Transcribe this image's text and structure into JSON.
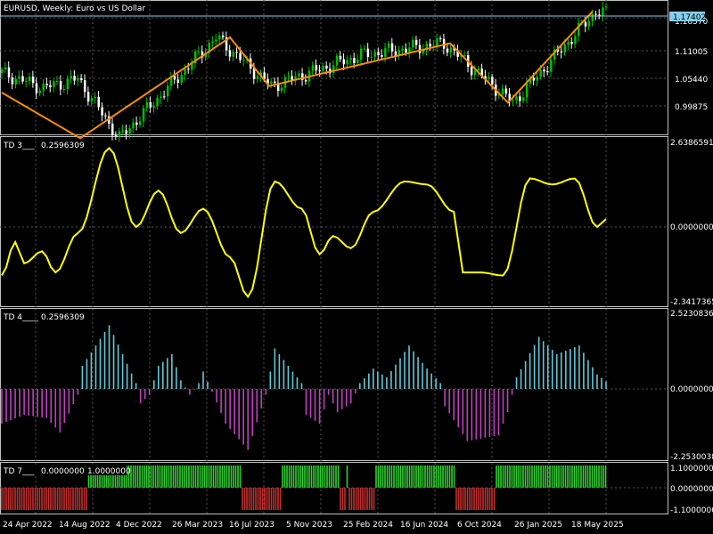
{
  "main_panel": {
    "title": "EURUSD, Weekly:  Euro vs US Dollar",
    "y_ticks": [
      "1.16570",
      "1.11005",
      "1.05440",
      "0.99875"
    ],
    "current_price": "1.17402",
    "colors": {
      "bull": "#00c000",
      "bear": "#ffffff",
      "zigzag": "#ff8c00",
      "price_line": "#87ceeb"
    }
  },
  "td3": {
    "label": "TD 3___",
    "value": "0.2596309",
    "y_ticks": [
      "2.6386591",
      "0.0000000",
      "-2.3417365"
    ],
    "color": "#ffff00"
  },
  "td4": {
    "label": "TD 4____",
    "value": "0.2596309",
    "y_ticks": [
      "2.5230836",
      "0.0000000",
      "-2.2530038"
    ],
    "colors": {
      "positive": "#5fc8d8",
      "negative": "#c040c0"
    }
  },
  "td7": {
    "label": "TD 7___",
    "values": [
      "0.0000000",
      "1.0000000"
    ],
    "y_ticks": [
      "1.1000000",
      "0.0000000",
      "-1.1000000"
    ],
    "colors": {
      "up": "#32cd32",
      "down": "#c03030"
    }
  },
  "x_axis": {
    "labels": [
      "24 Apr 2022",
      "14 Aug 2022",
      "4 Dec 2022",
      "26 Mar 2023",
      "16 Jul 2023",
      "5 Nov 2023",
      "25 Feb 2024",
      "16 Jun 2024",
      "6 Oct 2024",
      "26 Jan 2025",
      "18 May 2025"
    ]
  },
  "chart_data": {
    "type": "line",
    "symbol": "EURUSD",
    "timeframe": "Weekly",
    "x": [
      "24 Apr 2022",
      "14 Aug 2022",
      "4 Dec 2022",
      "26 Mar 2023",
      "16 Jul 2023",
      "5 Nov 2023",
      "25 Feb 2024",
      "16 Jun 2024",
      "6 Oct 2024",
      "26 Jan 2025",
      "18 May 2025"
    ],
    "series": [
      {
        "name": "TD 3___",
        "values": [
          -1.5,
          -0.6,
          2.6,
          0.0,
          1.0,
          -2.3,
          1.5,
          -1.2,
          1.8,
          -2.0,
          2.3,
          0.26
        ]
      },
      {
        "name": "TD 4____",
        "values": [
          -0.8,
          -0.9,
          2.3,
          0.2,
          1.2,
          -2.2,
          1.4,
          -0.8,
          1.6,
          -1.9,
          1.8,
          0.26
        ]
      },
      {
        "name": "TD 7___",
        "values": [
          -1,
          1,
          1,
          -1,
          1,
          -1,
          1,
          -1,
          1,
          1
        ]
      }
    ],
    "zigzag": [
      1.037,
      0.96,
      1.13,
      1.048,
      1.12,
      1.02,
      1.174
    ],
    "ylim_main": [
      0.968,
      1.19
    ]
  }
}
